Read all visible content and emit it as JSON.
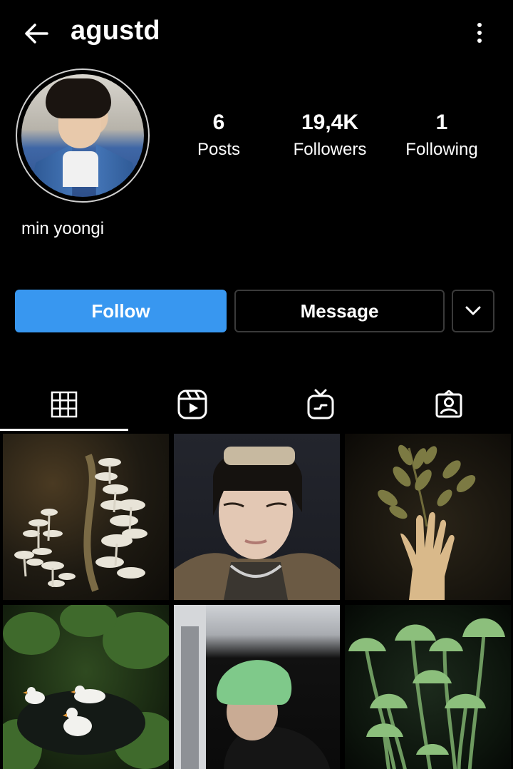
{
  "header": {
    "username": "agustd",
    "back_icon": "arrow-left-icon",
    "more_icon": "more-vertical-icon"
  },
  "profile": {
    "full_name": "min yoongi",
    "stats": {
      "posts": {
        "value": "6",
        "label": "Posts"
      },
      "followers": {
        "value": "19,4K",
        "label": "Followers"
      },
      "following": {
        "value": "1",
        "label": "Following"
      }
    }
  },
  "actions": {
    "follow_label": "Follow",
    "message_label": "Message",
    "more_icon": "chevron-down-icon"
  },
  "tabs": [
    {
      "icon": "grid-icon",
      "active": true
    },
    {
      "icon": "reels-icon",
      "active": false
    },
    {
      "icon": "igtv-icon",
      "active": false
    },
    {
      "icon": "tagged-icon",
      "active": false
    }
  ],
  "posts": [
    {
      "subject": "white mushrooms"
    },
    {
      "subject": "portrait with headband"
    },
    {
      "subject": "hand with plant"
    },
    {
      "subject": "ducks in pond"
    },
    {
      "subject": "green-haired person"
    },
    {
      "subject": "green mushrooms"
    }
  ],
  "colors": {
    "background": "#000000",
    "accent": "#3897f0",
    "text": "#ffffff",
    "border": "#3a3a3a"
  }
}
